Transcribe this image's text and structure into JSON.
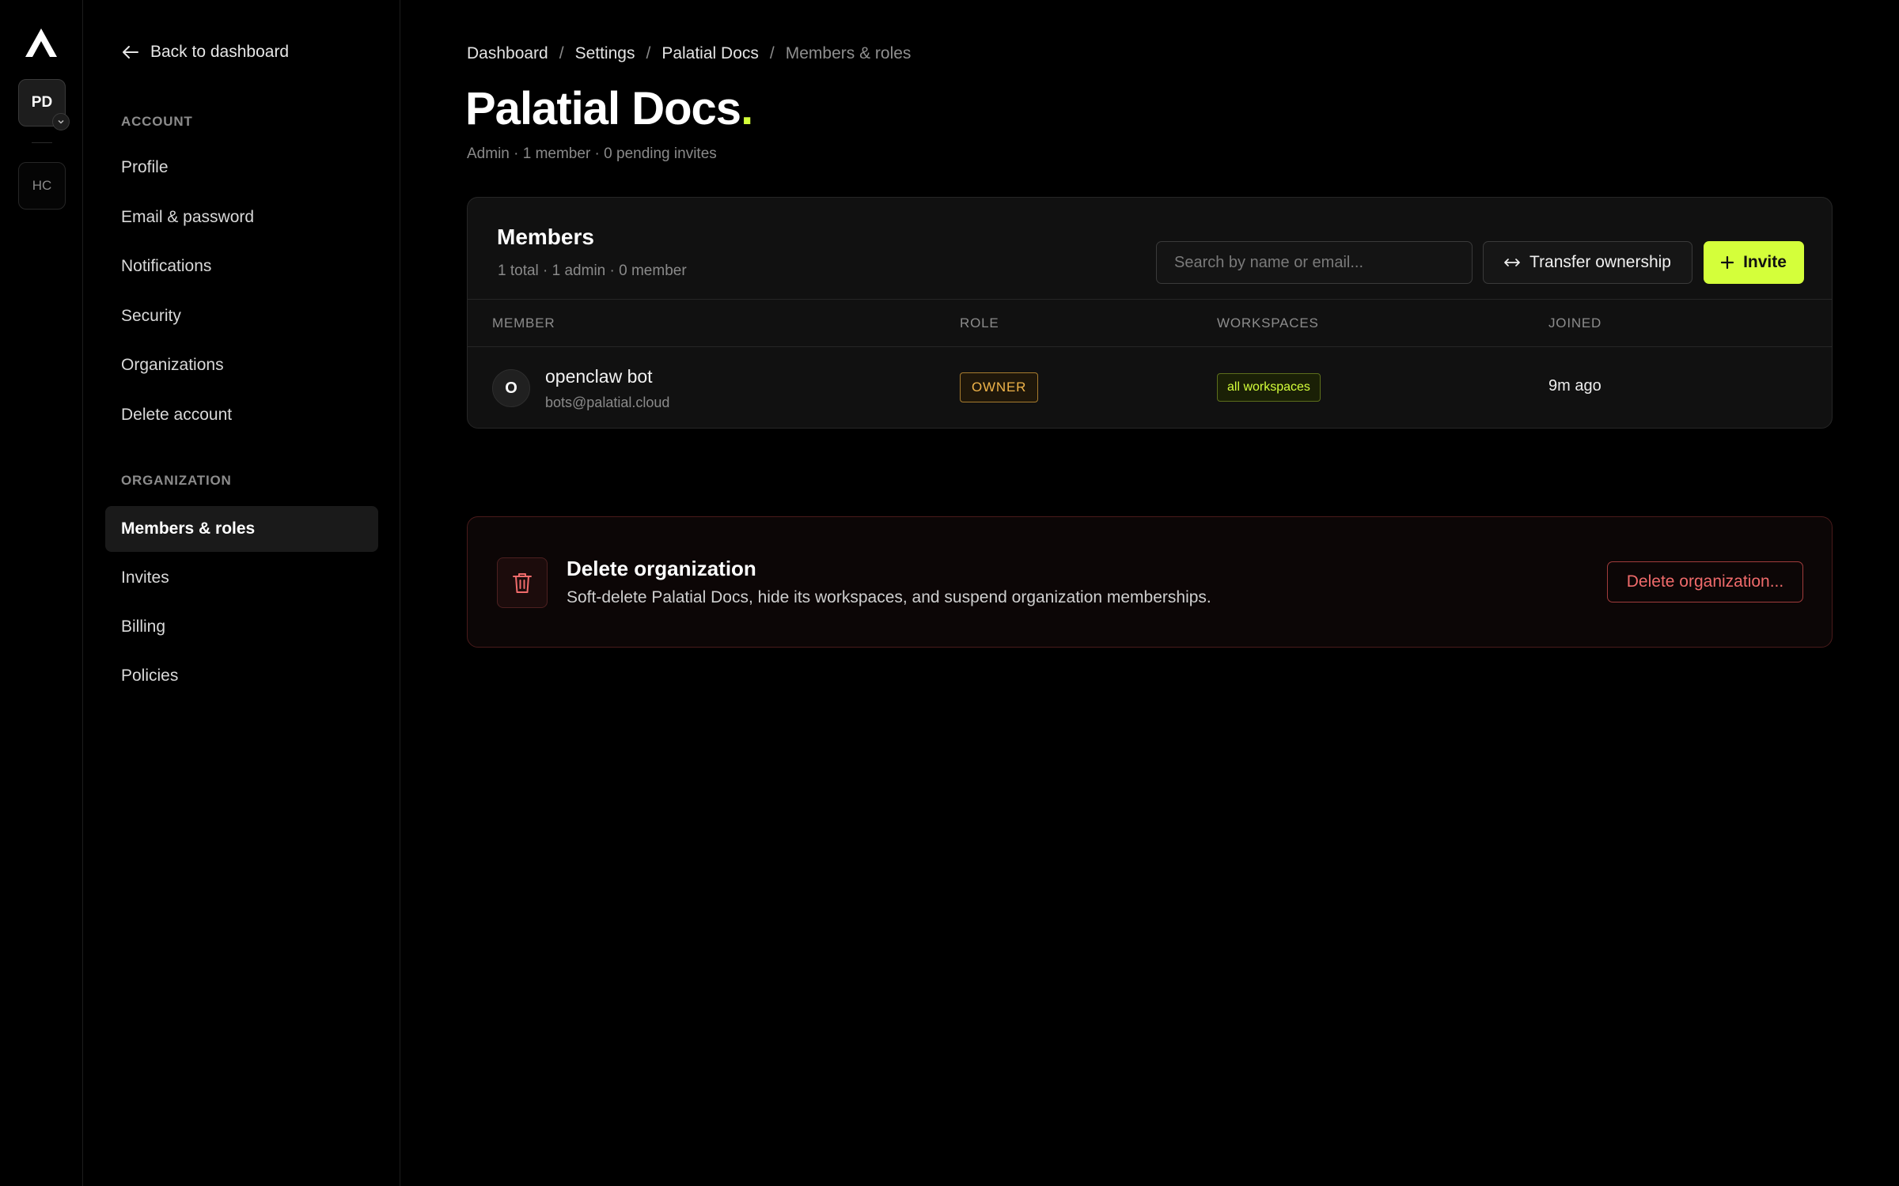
{
  "rail": {
    "orgs": [
      {
        "initials": "PD",
        "active": true
      },
      {
        "initials": "HC",
        "active": false
      }
    ]
  },
  "sidebar": {
    "back_label": "Back to dashboard",
    "account_title": "ACCOUNT",
    "account_items": [
      "Profile",
      "Email & password",
      "Notifications",
      "Security",
      "Organizations",
      "Delete account"
    ],
    "organization_title": "ORGANIZATION",
    "organization_items": [
      "Members & roles",
      "Invites",
      "Billing",
      "Policies"
    ],
    "active_item": "Members & roles"
  },
  "breadcrumb": [
    "Dashboard",
    "Settings",
    "Palatial Docs",
    "Members & roles"
  ],
  "page": {
    "title": "Palatial Docs",
    "title_dot": ".",
    "subtitle": "Admin · 1 member · 0 pending invites"
  },
  "members": {
    "title": "Members",
    "summary": "1 total · 1 admin · 0 member",
    "search_placeholder": "Search by name or email...",
    "transfer_label": "Transfer ownership",
    "invite_label": "Invite",
    "columns": [
      "MEMBER",
      "ROLE",
      "WORKSPACES",
      "JOINED"
    ],
    "rows": [
      {
        "avatar": "O",
        "name": "openclaw bot",
        "email": "bots@palatial.cloud",
        "role": "OWNER",
        "workspaces": "all workspaces",
        "joined": "9m ago"
      }
    ]
  },
  "danger": {
    "title": "Delete organization",
    "text": "Soft-delete Palatial Docs, hide its workspaces, and suspend organization memberships.",
    "button_label": "Delete organization..."
  },
  "colors": {
    "accent": "#d4ff3a",
    "owner": "#f0b44a",
    "danger": "#f06b6b",
    "background": "#000000"
  }
}
